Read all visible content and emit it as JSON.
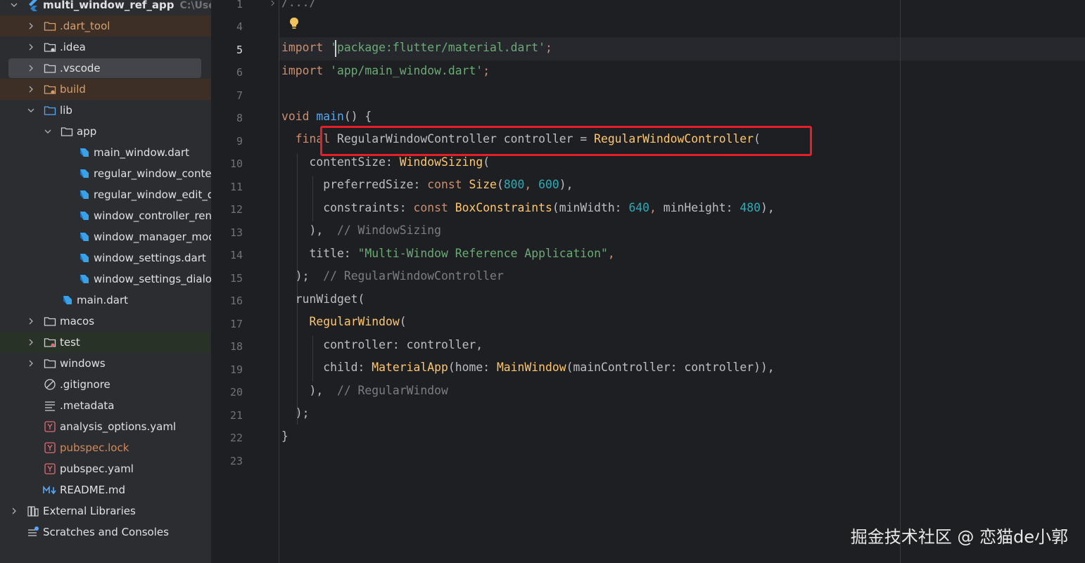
{
  "project": {
    "root_name": "multi_window_ref_app",
    "root_path": "C:\\Users\\",
    "items": [
      {
        "label": ".dart_tool"
      },
      {
        "label": ".idea"
      },
      {
        "label": ".vscode"
      },
      {
        "label": "build"
      },
      {
        "label": "lib"
      },
      {
        "label": "app"
      },
      {
        "label": "main_window.dart"
      },
      {
        "label": "regular_window_conte"
      },
      {
        "label": "regular_window_edit_d"
      },
      {
        "label": "window_controller_ren"
      },
      {
        "label": "window_manager_mod"
      },
      {
        "label": "window_settings.dart"
      },
      {
        "label": "window_settings_dialo"
      },
      {
        "label": "main.dart"
      },
      {
        "label": "macos"
      },
      {
        "label": "test"
      },
      {
        "label": "windows"
      },
      {
        "label": ".gitignore"
      },
      {
        "label": ".metadata"
      },
      {
        "label": "analysis_options.yaml"
      },
      {
        "label": "pubspec.lock"
      },
      {
        "label": "pubspec.yaml"
      },
      {
        "label": "README.md"
      },
      {
        "label": "External Libraries"
      },
      {
        "label": "Scratches and Consoles"
      }
    ]
  },
  "editor": {
    "line_numbers": [
      "1",
      "4",
      "5",
      "6",
      "7",
      "8",
      "9",
      "10",
      "11",
      "12",
      "13",
      "14",
      "15",
      "16",
      "17",
      "18",
      "19",
      "20",
      "21",
      "22",
      "23"
    ],
    "lines": [
      {
        "parts": [
          {
            "t": "/.../",
            "c": "cm"
          }
        ]
      },
      {
        "parts": []
      },
      {
        "parts": [
          {
            "t": "import ",
            "c": "kw"
          },
          {
            "t": "'package:flutter/material.dart'",
            "c": "str"
          },
          {
            "t": ";",
            "c": "kw"
          }
        ]
      },
      {
        "parts": [
          {
            "t": "import ",
            "c": "kw"
          },
          {
            "t": "'app/main_window.dart'",
            "c": "str"
          },
          {
            "t": ";",
            "c": "kw"
          }
        ]
      },
      {
        "parts": []
      },
      {
        "parts": [
          {
            "t": "void ",
            "c": "kw"
          },
          {
            "t": "main",
            "c": "fn"
          },
          {
            "t": "() {",
            "c": ""
          }
        ]
      },
      {
        "parts": [
          {
            "t": "  final ",
            "c": "kw"
          },
          {
            "t": "RegularWindowController controller = ",
            "c": ""
          },
          {
            "t": "RegularWindowController",
            "c": "cls"
          },
          {
            "t": "(",
            "c": ""
          }
        ]
      },
      {
        "parts": [
          {
            "t": "    contentSize: ",
            "c": ""
          },
          {
            "t": "WindowSizing",
            "c": "cls"
          },
          {
            "t": "(",
            "c": ""
          }
        ]
      },
      {
        "parts": [
          {
            "t": "      preferredSize: ",
            "c": ""
          },
          {
            "t": "const ",
            "c": "kw"
          },
          {
            "t": "Size",
            "c": "cls"
          },
          {
            "t": "(",
            "c": ""
          },
          {
            "t": "800",
            "c": "num"
          },
          {
            "t": ", ",
            "c": "kw"
          },
          {
            "t": "600",
            "c": "num"
          },
          {
            "t": "),",
            "c": ""
          }
        ]
      },
      {
        "parts": [
          {
            "t": "      constraints: ",
            "c": ""
          },
          {
            "t": "const ",
            "c": "kw"
          },
          {
            "t": "BoxConstraints",
            "c": "cls"
          },
          {
            "t": "(minWidth: ",
            "c": ""
          },
          {
            "t": "640",
            "c": "num"
          },
          {
            "t": ", ",
            "c": "kw"
          },
          {
            "t": "minHeight: ",
            "c": ""
          },
          {
            "t": "480",
            "c": "num"
          },
          {
            "t": "),",
            "c": ""
          }
        ]
      },
      {
        "parts": [
          {
            "t": "    ), ",
            "c": ""
          },
          {
            "t": " // WindowSizing",
            "c": "cm"
          }
        ]
      },
      {
        "parts": [
          {
            "t": "    title: ",
            "c": ""
          },
          {
            "t": "\"Multi-Window Reference Application\"",
            "c": "str"
          },
          {
            "t": ",",
            "c": "kw"
          }
        ]
      },
      {
        "parts": [
          {
            "t": "  );",
            "c": ""
          },
          {
            "t": "  // RegularWindowController",
            "c": "cm"
          }
        ]
      },
      {
        "parts": [
          {
            "t": "  runWidget(",
            "c": ""
          }
        ]
      },
      {
        "parts": [
          {
            "t": "    ",
            "c": ""
          },
          {
            "t": "RegularWindow",
            "c": "cls"
          },
          {
            "t": "(",
            "c": ""
          }
        ]
      },
      {
        "parts": [
          {
            "t": "      controller: controller,",
            "c": ""
          }
        ]
      },
      {
        "parts": [
          {
            "t": "      child: ",
            "c": ""
          },
          {
            "t": "MaterialApp",
            "c": "cls"
          },
          {
            "t": "(home: ",
            "c": ""
          },
          {
            "t": "MainWindow",
            "c": "cls"
          },
          {
            "t": "(mainController: controller)),",
            "c": ""
          }
        ]
      },
      {
        "parts": [
          {
            "t": "    ), ",
            "c": ""
          },
          {
            "t": " // RegularWindow",
            "c": "cm"
          }
        ]
      },
      {
        "parts": [
          {
            "t": "  );",
            "c": ""
          }
        ]
      },
      {
        "parts": [
          {
            "t": "}",
            "c": ""
          }
        ]
      },
      {
        "parts": []
      }
    ]
  },
  "watermark": "掘金技术社区 @ 恋猫de小郭"
}
